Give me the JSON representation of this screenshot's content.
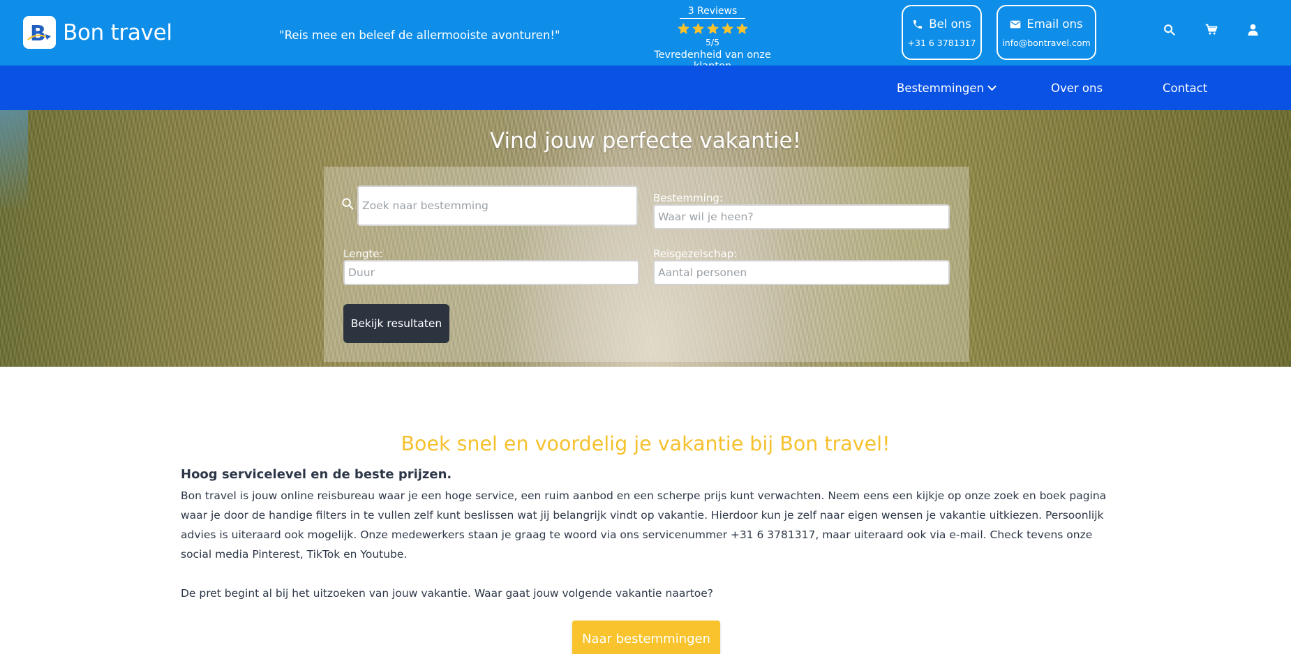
{
  "colors": {
    "header": "#0e8ee9",
    "nav": "#0a52e4",
    "accent": "#f6c12e",
    "stars": "#f8c32c",
    "dark_button": "#2c3440"
  },
  "header": {
    "brand": "Bon travel",
    "logo_letter": "B",
    "slogan": "\"Reis mee en beleef de allermooiste avonturen!\"",
    "reviews": {
      "count_label": "3 Reviews",
      "rating": 5,
      "score_label": "5/5",
      "caption": "Tevredenheid van onze klanten"
    },
    "call": {
      "label": "Bel ons",
      "value": "+31 6 3781317",
      "icon": "phone-icon"
    },
    "email": {
      "label": "Email ons",
      "value": "info@bontravel.com",
      "icon": "envelope-icon"
    },
    "icons": [
      "search-icon",
      "cart-icon",
      "user-icon"
    ]
  },
  "nav": {
    "items": [
      {
        "label": "Bestemmingen",
        "has_dropdown": true
      },
      {
        "label": "Over ons"
      },
      {
        "label": "Contact"
      }
    ]
  },
  "hero": {
    "title": "Vind jouw perfecte vakantie!",
    "search": {
      "placeholder": "Zoek naar bestemming",
      "destination_label": "Bestemming:",
      "destination_placeholder": "Waar wil je heen?",
      "length_label": "Lengte:",
      "length_placeholder": "Duur",
      "company_label": "Reisgezelschap:",
      "company_placeholder": "Aantal personen",
      "submit_label": "Bekijk resultaten"
    }
  },
  "intro": {
    "title": "Boek snel en voordelig je vakantie bij Bon travel!",
    "subtitle": "Hoog servicelevel en de beste prijzen.",
    "paragraph1": "Bon travel is jouw online reisbureau waar je een hoge service, een ruim aanbod en een scherpe prijs kunt verwachten. Neem eens een kijkje op onze zoek en boek pagina waar je door de handige filters in te vullen zelf kunt beslissen wat jij belangrijk vindt op vakantie. Hierdoor kun je zelf naar eigen wensen je vakantie uitkiezen. Persoonlijk advies is uiteraard ook mogelijk. Onze medewerkers staan je graag te woord via ons servicenummer +31 6 3781317, maar uiteraard ook via e-mail. Check tevens onze social media Pinterest, TikTok en Youtube.",
    "paragraph2": "De pret begint al bij het uitzoeken van jouw vakantie. Waar gaat jouw volgende vakantie naartoe?",
    "cta_label": "Naar bestemmingen"
  }
}
